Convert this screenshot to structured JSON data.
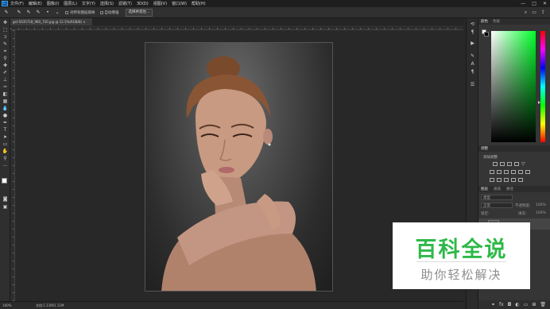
{
  "app": {
    "logo": "Ps"
  },
  "menu": [
    "文件(F)",
    "编辑(E)",
    "图像(I)",
    "图层(L)",
    "文字(Y)",
    "选择(S)",
    "滤镜(T)",
    "3D(D)",
    "视图(V)",
    "窗口(W)",
    "帮助(H)"
  ],
  "window_controls": {
    "minimize": "—",
    "maximize": "□",
    "close": "✕"
  },
  "options_bar": {
    "checkbox1": "对所有图层取样",
    "checkbox2": "自动增强",
    "button": "选择并遮住..."
  },
  "document": {
    "tab_title": "gst-5035718_960_720.jpg @ 12.5%(RGB/8) ×"
  },
  "status": {
    "zoom": "100%",
    "doc_info": "文档:1.11M/1.11M"
  },
  "panels": {
    "color_tab": "颜色",
    "swatches_tab": "色板",
    "adjustments_tab": "调整",
    "add_adjustment": "添加调整",
    "layers_tab": "图层",
    "channels_tab": "通道",
    "paths_tab": "路径",
    "layer_kind": "类型",
    "blend_mode": "正常",
    "opacity_label": "不透明度:",
    "opacity_value": "100%",
    "lock_label": "锁定:",
    "fill_label": "填充:",
    "fill_value": "100%"
  },
  "colors": {
    "accent": "#31a8ff",
    "watermark_green": "#2eb94a"
  },
  "watermark": {
    "title": "百科全说",
    "subtitle": "助你轻松解决"
  }
}
